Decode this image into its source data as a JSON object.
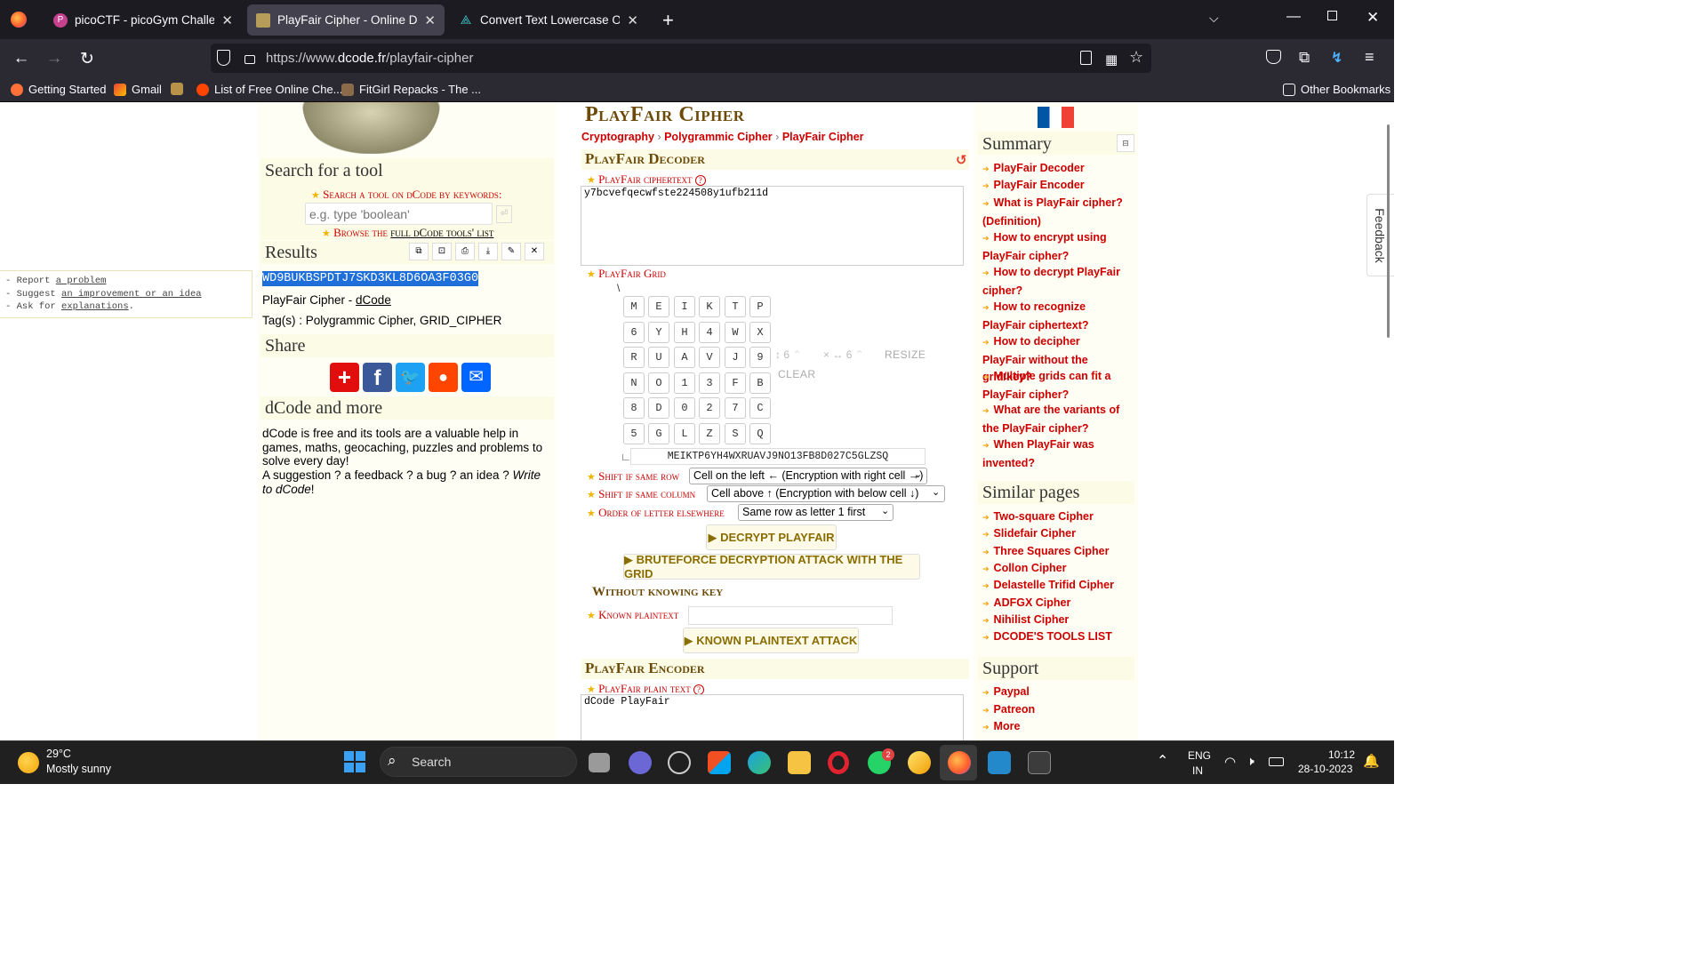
{
  "browser": {
    "tabs": [
      {
        "label": "picoCTF - picoGym Challenges",
        "active": false
      },
      {
        "label": "PlayFair Cipher - Online Decoder",
        "active": true
      },
      {
        "label": "Convert Text Lowercase Online",
        "active": false
      }
    ],
    "url_prefix": "https://www.",
    "url_domain": "dcode.fr",
    "url_path": "/playfair-cipher",
    "bookmarks": [
      "Getting Started",
      "Gmail",
      "List of Free Online Che...",
      "FitGirl Repacks - The ..."
    ],
    "other_bookmarks": "Other Bookmarks"
  },
  "left": {
    "search_title": "Search for a tool",
    "search_label": "Search a tool on dCode by keywords:",
    "search_placeholder": "e.g. type 'boolean'",
    "browse_prefix": "Browse the",
    "browse_link": "full dCode tools' list",
    "results_title": "Results",
    "result_value": "WD9BUKBSPDTJ7SKD3KL8D6OA3F03G0",
    "result_source_prefix": "PlayFair Cipher -",
    "result_source_link": "dCode",
    "tags": "Tag(s) : Polygrammic Cipher, GRID_CIPHER",
    "share_title": "Share",
    "more_title": "dCode and more",
    "more_text": "dCode is free and its tools are a valuable help in games, maths, geocaching, puzzles and problems to solve every day!",
    "suggestion_text": "A suggestion ? a feedback ? a bug ? an idea ?",
    "write_to": "Write to dCode",
    "report": {
      "l1_prefix": "- Report",
      "l1_link": "a problem",
      "l2_prefix": "- Suggest",
      "l2_link": "an improvement or an idea",
      "l3_prefix": "- Ask for",
      "l3_link": "explanations",
      "l3_suffix": "."
    }
  },
  "main": {
    "page_title": "PlayFair Cipher",
    "breadcrumb": [
      "Cryptography",
      "Polygrammic Cipher",
      "PlayFair Cipher"
    ],
    "decoder_title": "PlayFair Decoder",
    "ciphertext_label": "PlayFair ciphertext",
    "ciphertext_value": "y7bcvefqecwfste224508y1ufb211d",
    "grid_label": "PlayFair Grid",
    "grid_corner": "\\",
    "grid": [
      [
        "M",
        "E",
        "I",
        "K",
        "T",
        "P"
      ],
      [
        "6",
        "Y",
        "H",
        "4",
        "W",
        "X"
      ],
      [
        "R",
        "U",
        "A",
        "V",
        "J",
        "9"
      ],
      [
        "N",
        "O",
        "1",
        "3",
        "F",
        "B"
      ],
      [
        "8",
        "D",
        "0",
        "2",
        "7",
        "C"
      ],
      [
        "5",
        "G",
        "L",
        "Z",
        "S",
        "Q"
      ]
    ],
    "grid_rows_value": "6",
    "grid_cols_value": "6",
    "resize_label": "Resize",
    "clear_label": "Clear",
    "grid_string": "MEIKTP6YH4WXRUAVJ9NO13FB8D027C5GLZSQ",
    "grid_string_corner": "∟",
    "shift_row_label": "Shift if same row",
    "shift_row_value": "Cell on the left ← (Encryption with right cell →)",
    "shift_col_label": "Shift if same column",
    "shift_col_value": "Cell above ↑ (Encryption with below cell ↓)",
    "order_label": "Order of letter elsewhere",
    "order_value": "Same row as letter 1 first",
    "decrypt_button": "▶ Decrypt PlayFair",
    "bruteforce_button": "▶ Bruteforce decryption attack with the grid",
    "without_key_title": "Without knowing key",
    "known_plaintext_label": "Known plaintext",
    "known_plaintext_button": "▶ Known plaintext attack",
    "encoder_title": "PlayFair Encoder",
    "plaintext_label": "PlayFair plain text",
    "plaintext_value": "dCode PlayFair"
  },
  "right": {
    "summary_title": "Summary",
    "summary_items": [
      "PlayFair Decoder",
      "PlayFair Encoder",
      "What is PlayFair cipher? (Definition)",
      "How to encrypt using PlayFair cipher?",
      "How to decrypt PlayFair cipher?",
      "How to recognize PlayFair ciphertext?",
      "How to decipher PlayFair without the grid/key?",
      "Multiple grids can fit a PlayFair cipher?",
      "What are the variants of the PlayFair cipher?",
      "When PlayFair was invented?"
    ],
    "similar_title": "Similar pages",
    "similar_items": [
      "Two-square Cipher",
      "Slidefair Cipher",
      "Three Squares Cipher",
      "Collon Cipher",
      "Delastelle Trifid Cipher",
      "ADFGX Cipher",
      "Nihilist Cipher",
      "DCODE'S TOOLS LIST"
    ],
    "support_title": "Support",
    "support_items": [
      "Paypal",
      "Patreon",
      "More"
    ],
    "feedback": "Feedback"
  },
  "taskbar": {
    "temp": "29°C",
    "weather": "Mostly sunny",
    "search": "Search",
    "lang1": "ENG",
    "lang2": "IN",
    "time": "10:12",
    "date": "28-10-2023",
    "badge": "2"
  }
}
